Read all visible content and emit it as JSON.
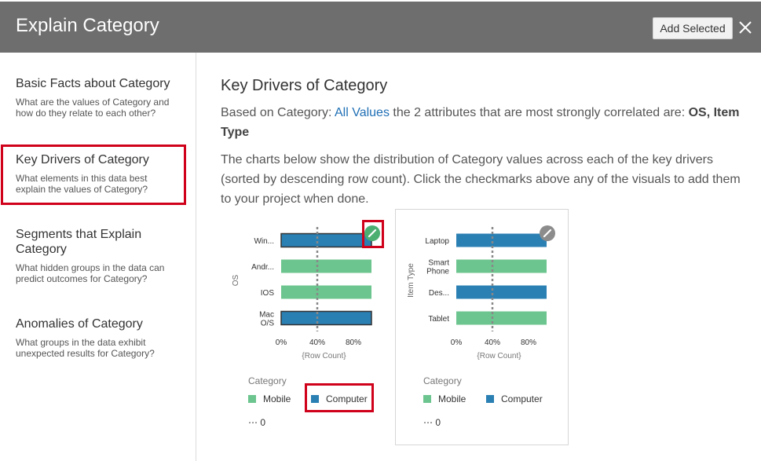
{
  "header": {
    "title": "Explain Category",
    "add_button": "Add Selected",
    "close_icon": "close-icon"
  },
  "sidebar": {
    "items": [
      {
        "title": "Basic Facts about Category",
        "desc": "What are the values of Category and how do they relate to each other?"
      },
      {
        "title": "Key Drivers of Category",
        "desc": "What elements in this data best explain the values of Category?"
      },
      {
        "title": "Segments that Explain Category",
        "desc": "What hidden groups in the data can predict outcomes for Category?"
      },
      {
        "title": "Anomalies of Category",
        "desc": "What groups in the data exhibit unexpected results for Category?"
      }
    ]
  },
  "main": {
    "title": "Key Drivers of Category",
    "intro_prefix": "Based on Category: ",
    "intro_link": "All Values",
    "intro_middle": " the 2 attributes that are most strongly correlated are: ",
    "intro_bold": "OS, Item Type",
    "description": "The charts below show the distribution of Category values across each of the key drivers (sorted by descending row count). Click the checkmarks above any of the visuals to add them to your project when done."
  },
  "colors": {
    "mobile": "#6cc58e",
    "computer": "#2a7fb3",
    "header_bg": "#6e6e6e",
    "highlight": "#d0021b",
    "check_selected": "#4caf72",
    "check_unselected": "#8c8c8c"
  },
  "chart_data": [
    {
      "type": "bar",
      "orientation": "horizontal",
      "stacked": true,
      "percent": true,
      "ylabel": "OS",
      "xlabel": "{Row Count}",
      "categories": [
        "Win...",
        "Andr...",
        "IOS",
        "Mac O/S"
      ],
      "series": [
        {
          "name": "Mobile",
          "values": [
            0,
            100,
            100,
            0
          ]
        },
        {
          "name": "Computer",
          "values": [
            100,
            0,
            0,
            100
          ]
        }
      ],
      "xticks": [
        "0%",
        "40%",
        "80%"
      ],
      "reference_line": 40,
      "xlim": [
        0,
        100
      ],
      "selected": true,
      "legend": {
        "title": "Category",
        "entries": [
          "Mobile",
          "Computer"
        ],
        "more_label": "0"
      }
    },
    {
      "type": "bar",
      "orientation": "horizontal",
      "stacked": true,
      "percent": true,
      "ylabel": "Item Type",
      "xlabel": "{Row Count}",
      "categories": [
        "Laptop",
        "Smart Phone",
        "Des...",
        "Tablet"
      ],
      "series": [
        {
          "name": "Mobile",
          "values": [
            0,
            100,
            0,
            100
          ]
        },
        {
          "name": "Computer",
          "values": [
            100,
            0,
            100,
            0
          ]
        }
      ],
      "xticks": [
        "0%",
        "40%",
        "80%"
      ],
      "reference_line": 40,
      "xlim": [
        0,
        100
      ],
      "selected": false,
      "legend": {
        "title": "Category",
        "entries": [
          "Mobile",
          "Computer"
        ],
        "more_label": "0"
      }
    }
  ]
}
